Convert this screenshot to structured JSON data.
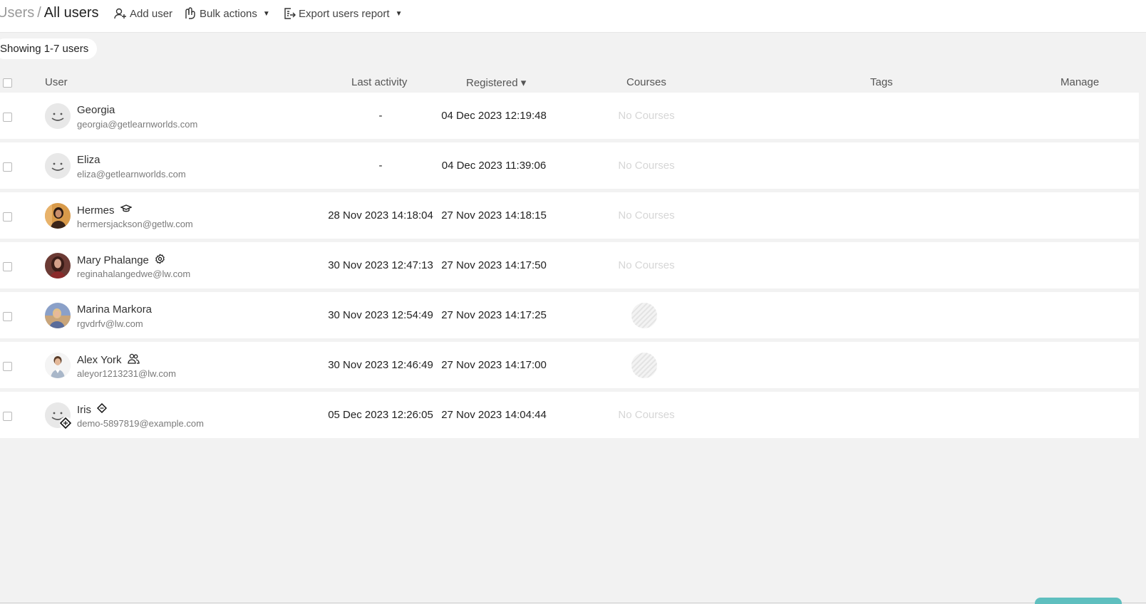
{
  "breadcrumb": {
    "parent": "Users",
    "separator": "/",
    "current": "All users"
  },
  "toolbar": {
    "add_user": "Add user",
    "bulk_actions": "Bulk actions",
    "export_report": "Export users report",
    "dropdown_caret": "▼"
  },
  "showing": "Showing 1-7 users",
  "columns": {
    "user": "User",
    "last_activity": "Last activity",
    "registered": "Registered ▾",
    "courses": "Courses",
    "tags": "Tags",
    "manage": "Manage"
  },
  "users": [
    {
      "name": "Georgia",
      "email": "georgia@getlearnworlds.com",
      "last_activity": "-",
      "registered": "04 Dec 2023 12:19:48",
      "courses": "No Courses",
      "avatar": "smiley-avatar",
      "role_icon": ""
    },
    {
      "name": "Eliza",
      "email": "eliza@getlearnworlds.com",
      "last_activity": "-",
      "registered": "04 Dec 2023 11:39:06",
      "courses": "No Courses",
      "avatar": "smiley-avatar",
      "role_icon": ""
    },
    {
      "name": "Hermes",
      "email": "hermersjackson@getlw.com",
      "last_activity": "28 Nov 2023 14:18:04",
      "registered": "27 Nov 2023 14:18:15",
      "courses": "No Courses",
      "avatar": "photo-avatar",
      "role_icon": "graduation-cap-icon"
    },
    {
      "name": "Mary Phalange",
      "email": "reginahalangedwe@lw.com",
      "last_activity": "30 Nov 2023 12:47:13",
      "registered": "27 Nov 2023 14:17:50",
      "courses": "No Courses",
      "avatar": "photo-avatar",
      "role_icon": "gear-badge-icon"
    },
    {
      "name": "Marina Markora",
      "email": "rgvdrfv@lw.com",
      "last_activity": "30 Nov 2023 12:54:49",
      "registered": "27 Nov 2023 14:17:25",
      "courses": "",
      "avatar": "photo-avatar",
      "role_icon": ""
    },
    {
      "name": "Alex York",
      "email": "aleyor1213231@lw.com",
      "last_activity": "30 Nov 2023 12:46:49",
      "registered": "27 Nov 2023 14:17:00",
      "courses": "",
      "avatar": "photo-avatar",
      "role_icon": "users-icon"
    },
    {
      "name": "Iris",
      "email": "demo-5897819@example.com",
      "last_activity": "05 Dec 2023 12:26:05",
      "registered": "27 Nov 2023 14:04:44",
      "courses": "No Courses",
      "avatar": "smiley-avatar",
      "role_icon": "diamond-icon"
    }
  ],
  "colors": {
    "accent": "#5fbfbf",
    "background": "#f2f2f2",
    "muted_text": "#d6d6d6"
  }
}
